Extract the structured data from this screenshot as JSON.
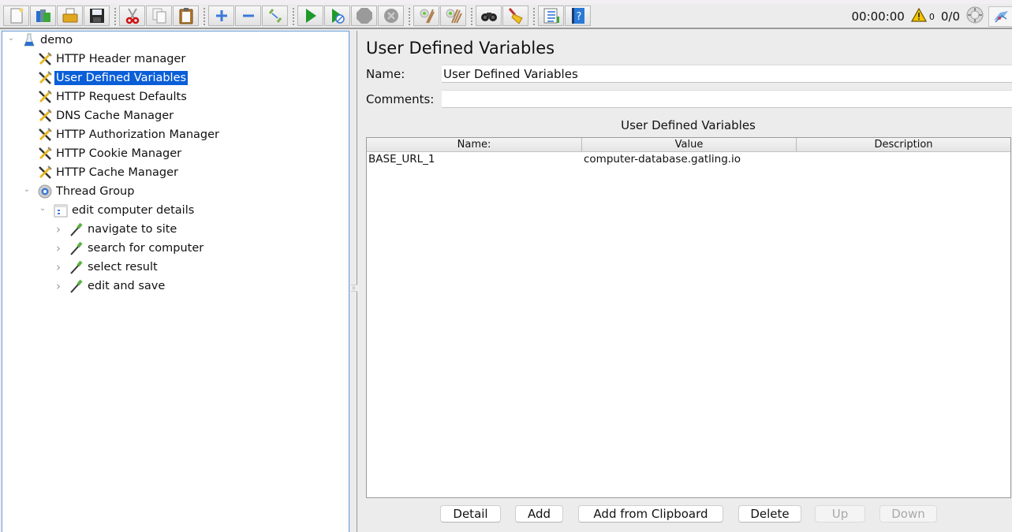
{
  "toolbar": {
    "buttons": [
      {
        "id": "new",
        "icon": "new-document-icon",
        "enabled": true
      },
      {
        "id": "templates",
        "icon": "templates-icon",
        "enabled": true
      },
      {
        "id": "open",
        "icon": "open-folder-icon",
        "enabled": true
      },
      {
        "id": "save",
        "icon": "save-icon",
        "enabled": true
      },
      {
        "id": "cut",
        "icon": "cut-icon",
        "enabled": true
      },
      {
        "id": "copy",
        "icon": "copy-icon",
        "enabled": true
      },
      {
        "id": "paste",
        "icon": "paste-icon",
        "enabled": true
      },
      {
        "id": "expand",
        "icon": "expand-plus-icon",
        "enabled": true
      },
      {
        "id": "collapse",
        "icon": "collapse-minus-icon",
        "enabled": true
      },
      {
        "id": "toggle",
        "icon": "toggle-icon",
        "enabled": true
      },
      {
        "id": "start",
        "icon": "start-icon",
        "enabled": true
      },
      {
        "id": "start-no-pauses",
        "icon": "start-no-pauses-icon",
        "enabled": true
      },
      {
        "id": "stop",
        "icon": "stop-icon",
        "enabled": false
      },
      {
        "id": "shutdown",
        "icon": "shutdown-icon",
        "enabled": false
      },
      {
        "id": "clear",
        "icon": "clear-icon",
        "enabled": true
      },
      {
        "id": "clear-all",
        "icon": "clear-all-icon",
        "enabled": true
      },
      {
        "id": "search",
        "icon": "search-binoculars-icon",
        "enabled": true
      },
      {
        "id": "reset-search",
        "icon": "reset-search-broom-icon",
        "enabled": true
      },
      {
        "id": "function-helper",
        "icon": "function-helper-icon",
        "enabled": true
      },
      {
        "id": "help",
        "icon": "help-icon",
        "enabled": true
      }
    ]
  },
  "status": {
    "elapsed_time": "00:00:00",
    "warning_count": "0",
    "active_threads": "0/0"
  },
  "tree": {
    "items": [
      {
        "label": "demo",
        "icon": "test-plan-flask-icon",
        "level": 0,
        "toggle": "expanded",
        "selected": false
      },
      {
        "label": "HTTP Header manager",
        "icon": "config-tools-icon",
        "level": 1,
        "toggle": "none",
        "selected": false
      },
      {
        "label": "User Defined Variables",
        "icon": "config-tools-icon",
        "level": 1,
        "toggle": "none",
        "selected": true
      },
      {
        "label": "HTTP Request Defaults",
        "icon": "config-tools-icon",
        "level": 1,
        "toggle": "none",
        "selected": false
      },
      {
        "label": "DNS Cache Manager",
        "icon": "config-tools-icon",
        "level": 1,
        "toggle": "none",
        "selected": false
      },
      {
        "label": "HTTP Authorization Manager",
        "icon": "config-tools-icon",
        "level": 1,
        "toggle": "none",
        "selected": false
      },
      {
        "label": "HTTP Cookie Manager",
        "icon": "config-tools-icon",
        "level": 1,
        "toggle": "none",
        "selected": false
      },
      {
        "label": "HTTP Cache Manager",
        "icon": "config-tools-icon",
        "level": 1,
        "toggle": "none",
        "selected": false
      },
      {
        "label": "Thread Group",
        "icon": "thread-group-gear-icon",
        "level": 1,
        "toggle": "expanded",
        "selected": false
      },
      {
        "label": "edit computer details",
        "icon": "transaction-controller-icon",
        "level": 2,
        "toggle": "expanded",
        "selected": false
      },
      {
        "label": "navigate to site",
        "icon": "sampler-pipette-icon",
        "level": 3,
        "toggle": "collapsed",
        "selected": false
      },
      {
        "label": "search for computer",
        "icon": "sampler-pipette-icon",
        "level": 3,
        "toggle": "collapsed",
        "selected": false
      },
      {
        "label": "select result",
        "icon": "sampler-pipette-icon",
        "level": 3,
        "toggle": "collapsed",
        "selected": false
      },
      {
        "label": "edit and save",
        "icon": "sampler-pipette-icon",
        "level": 3,
        "toggle": "collapsed",
        "selected": false
      }
    ]
  },
  "panel": {
    "title": "User Defined Variables",
    "name_label": "Name:",
    "name_value": "User Defined Variables",
    "comments_label": "Comments:",
    "comments_value": "",
    "table_caption": "User Defined Variables",
    "columns": [
      "Name:",
      "Value",
      "Description"
    ],
    "rows": [
      [
        "BASE_URL_1",
        "computer-database.gatling.io",
        ""
      ]
    ],
    "buttons": [
      {
        "label": "Detail",
        "enabled": true
      },
      {
        "label": "Add",
        "enabled": true
      },
      {
        "label": "Add from Clipboard",
        "enabled": true
      },
      {
        "label": "Delete",
        "enabled": true
      },
      {
        "label": "Up",
        "enabled": false
      },
      {
        "label": "Down",
        "enabled": false
      }
    ]
  },
  "colors": {
    "selection": "#0a5fd8",
    "tree_border": "#6aa3dc",
    "panel_bg": "#ececec"
  }
}
